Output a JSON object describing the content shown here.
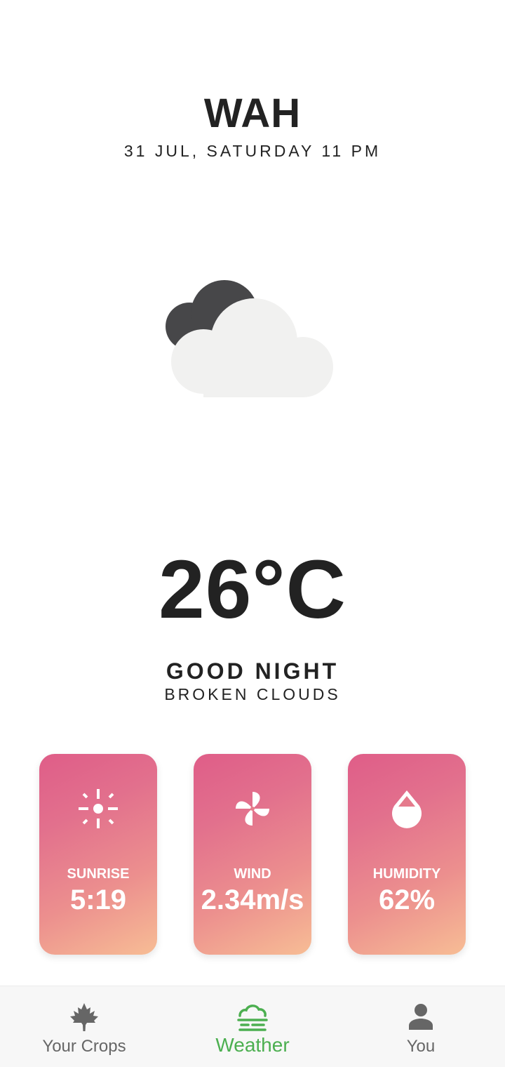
{
  "location": {
    "city": "WAH",
    "datetime": "31 JUL, SATURDAY 11 PM"
  },
  "current": {
    "icon": "broken-clouds-night-icon",
    "temperature": "26°C",
    "greeting": "GOOD NIGHT",
    "condition": "BROKEN CLOUDS"
  },
  "stats": [
    {
      "label": "SUNRISE",
      "value": "5:19",
      "icon": "sun-icon"
    },
    {
      "label": "WIND",
      "value": "2.34m/s",
      "icon": "fan-icon"
    },
    {
      "label": "HUMIDITY",
      "value": "62%",
      "icon": "droplet-icon"
    }
  ],
  "colors": {
    "accent": "#4caf50",
    "card_gradient_start": "#df5d88",
    "card_gradient_end": "#f7bd95",
    "nav_inactive": "#666666"
  },
  "nav": {
    "items": [
      {
        "label": "Your Crops",
        "icon": "maple-leaf-icon",
        "active": false
      },
      {
        "label": "Weather",
        "icon": "fog-cloud-icon",
        "active": true
      },
      {
        "label": "You",
        "icon": "person-icon",
        "active": false
      }
    ]
  }
}
